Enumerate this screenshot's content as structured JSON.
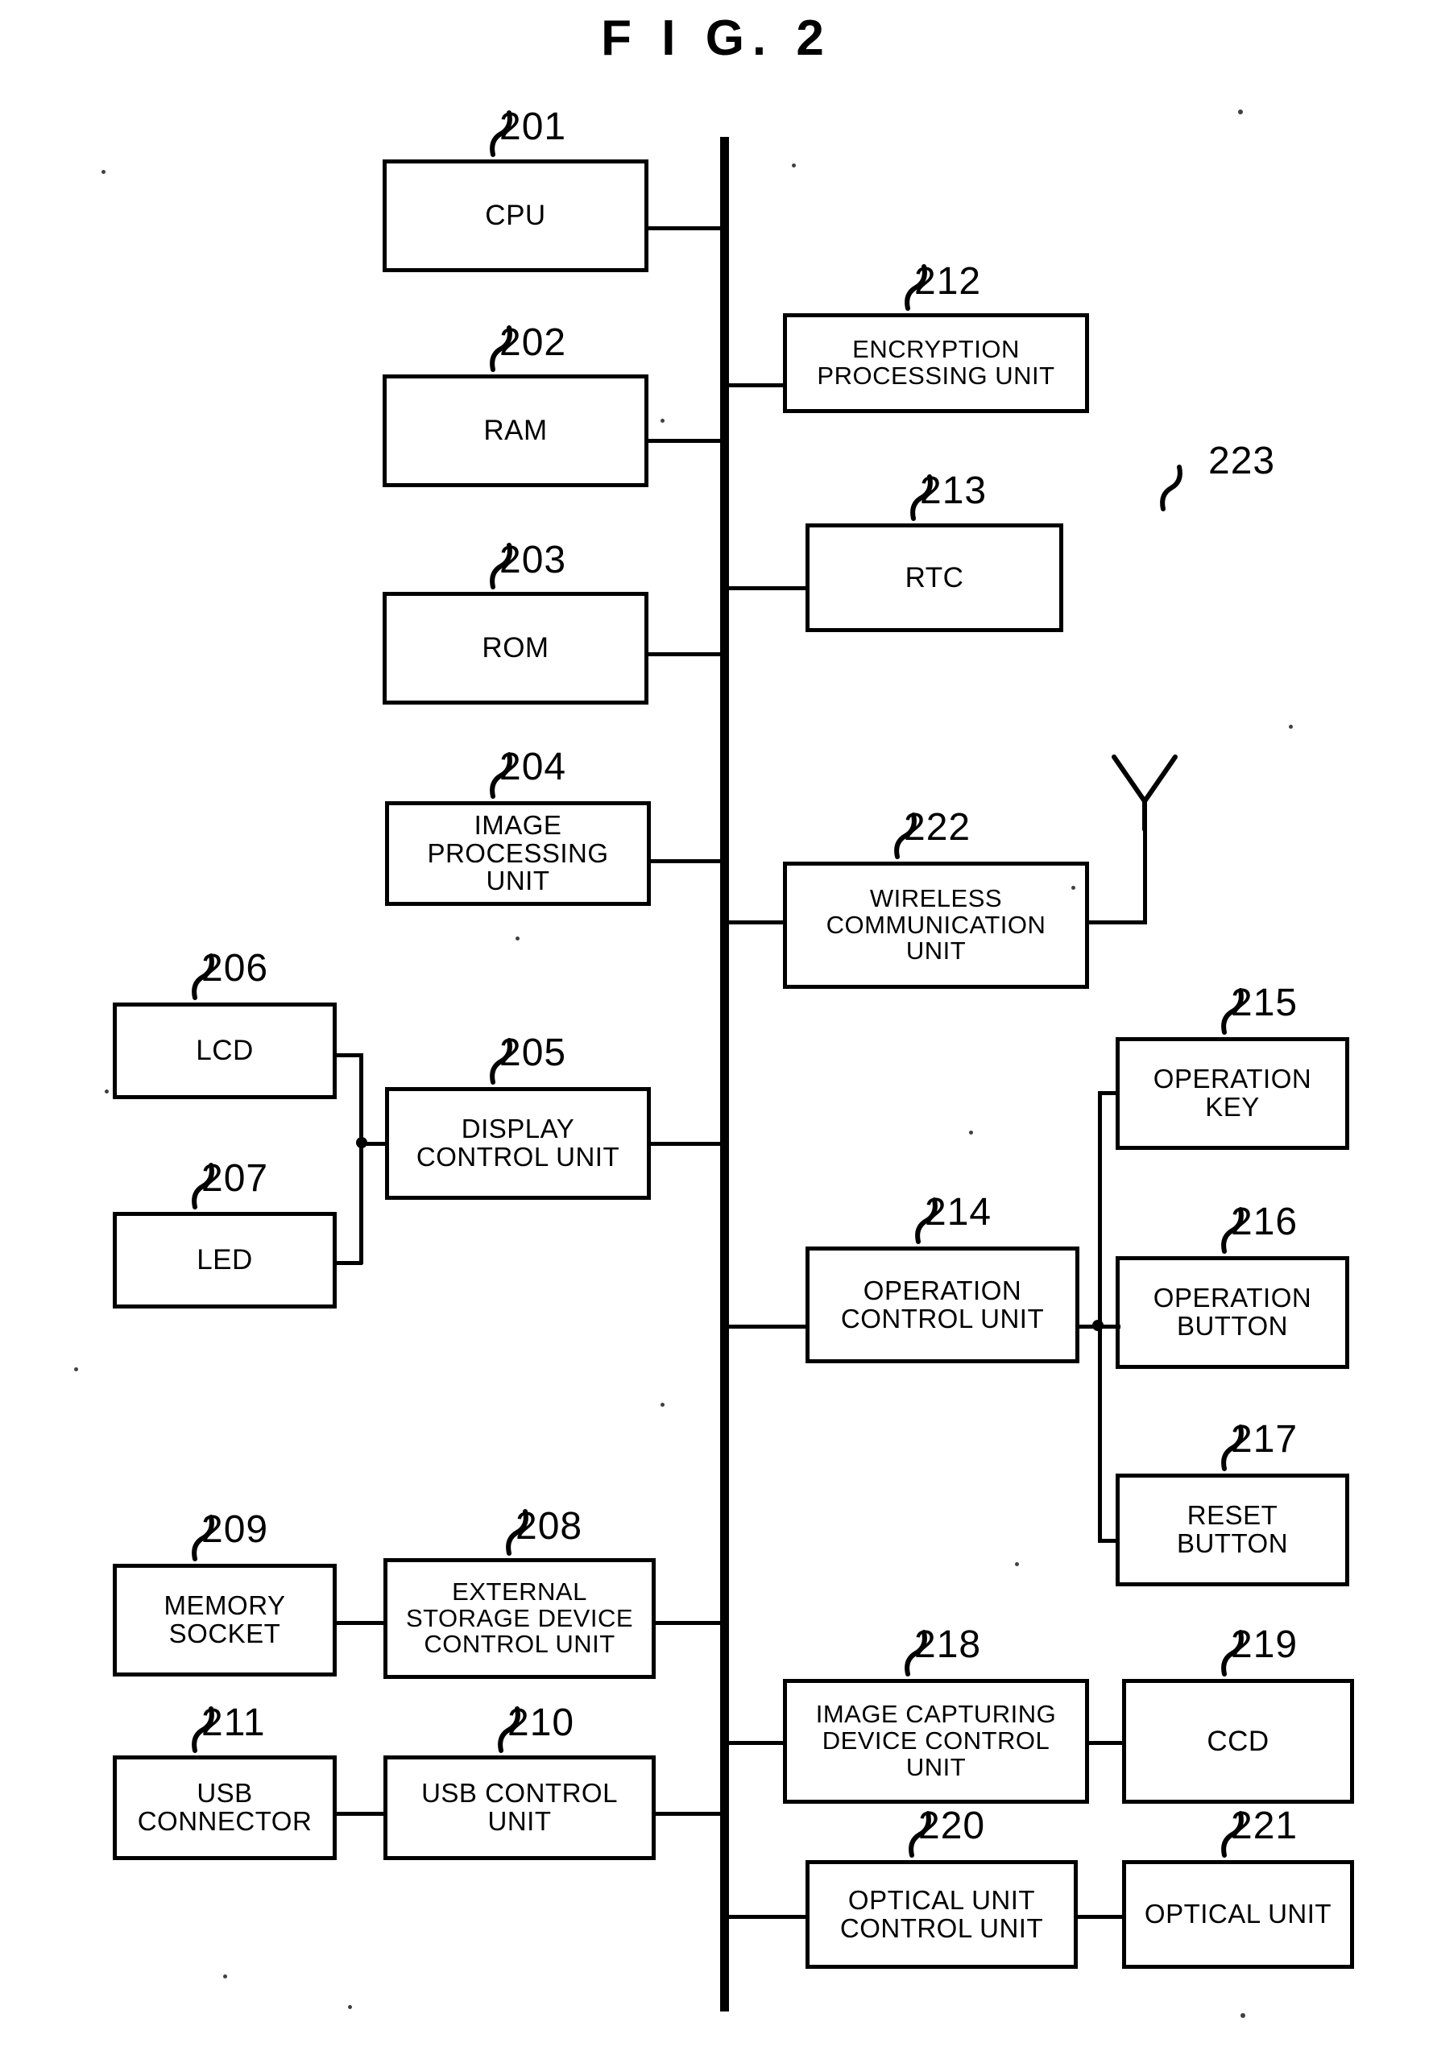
{
  "figure": {
    "title": "F I G.  2"
  },
  "bus": {
    "name": "system-bus"
  },
  "blocks": [
    {
      "id": "cpu",
      "ref": "201",
      "label": "CPU"
    },
    {
      "id": "ram",
      "ref": "202",
      "label": "RAM"
    },
    {
      "id": "rom",
      "ref": "203",
      "label": "ROM"
    },
    {
      "id": "image_proc",
      "ref": "204",
      "label": "IMAGE\nPROCESSING\nUNIT"
    },
    {
      "id": "display_ctrl",
      "ref": "205",
      "label": "DISPLAY\nCONTROL UNIT"
    },
    {
      "id": "lcd",
      "ref": "206",
      "label": "LCD"
    },
    {
      "id": "led",
      "ref": "207",
      "label": "LED"
    },
    {
      "id": "ext_storage",
      "ref": "208",
      "label": "EXTERNAL\nSTORAGE DEVICE\nCONTROL UNIT"
    },
    {
      "id": "memory_socket",
      "ref": "209",
      "label": "MEMORY\nSOCKET"
    },
    {
      "id": "usb_ctrl",
      "ref": "210",
      "label": "USB CONTROL\nUNIT"
    },
    {
      "id": "usb_connector",
      "ref": "211",
      "label": "USB\nCONNECTOR"
    },
    {
      "id": "encryption",
      "ref": "212",
      "label": "ENCRYPTION\nPROCESSING UNIT"
    },
    {
      "id": "rtc",
      "ref": "213",
      "label": "RTC"
    },
    {
      "id": "operation_ctrl",
      "ref": "214",
      "label": "OPERATION\nCONTROL UNIT"
    },
    {
      "id": "operation_key",
      "ref": "215",
      "label": "OPERATION\nKEY"
    },
    {
      "id": "operation_btn",
      "ref": "216",
      "label": "OPERATION\nBUTTON"
    },
    {
      "id": "reset_btn",
      "ref": "217",
      "label": "RESET\nBUTTON"
    },
    {
      "id": "capture_ctrl",
      "ref": "218",
      "label": "IMAGE CAPTURING\nDEVICE CONTROL\nUNIT"
    },
    {
      "id": "ccd",
      "ref": "219",
      "label": "CCD"
    },
    {
      "id": "optical_ctrl",
      "ref": "220",
      "label": "OPTICAL UNIT\nCONTROL UNIT"
    },
    {
      "id": "optical_unit",
      "ref": "221",
      "label": "OPTICAL UNIT"
    },
    {
      "id": "wireless",
      "ref": "222",
      "label": "WIRELESS\nCOMMUNICATION\nUNIT"
    },
    {
      "id": "antenna",
      "ref": "223",
      "label": ""
    }
  ],
  "antenna": {
    "ref": "223",
    "name": "antenna-symbol"
  },
  "colors": {
    "ink": "#000000",
    "paper": "#ffffff"
  }
}
